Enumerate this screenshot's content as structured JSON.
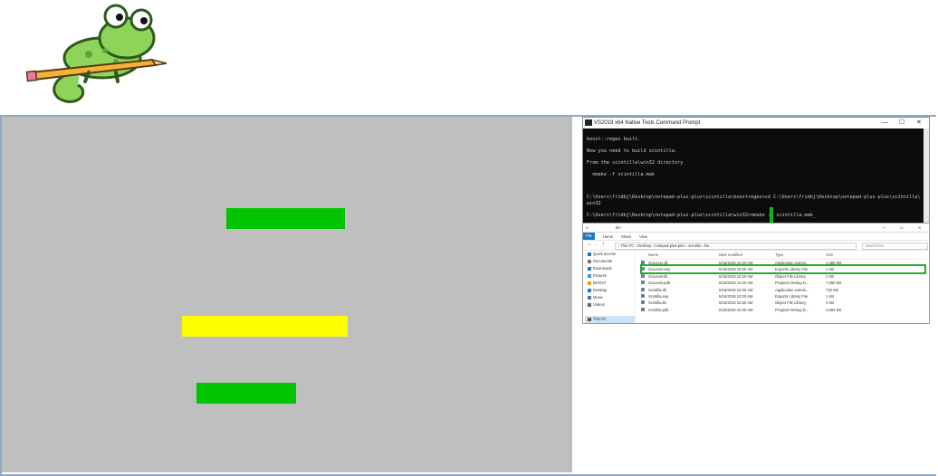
{
  "colors": {
    "highlight_green": "#00c400",
    "highlight_yellow": "#ffff00",
    "panel_gray": "#bfbfbf",
    "selection_green": "#24b024",
    "explorer_blue": "#1979ca"
  },
  "terminal": {
    "title": "VS2019 x64 Native Tools Command Prompt",
    "lines": [
      "",
      "boost::regex built.",
      "",
      "Now you need to build scintilla.",
      "",
      "From the scintilla\\win32 directory",
      "",
      "  nmake -f scintilla.mak",
      "",
      "",
      "",
      "C:\\Users\\fridbj\\Desktop\\notepad-plus-plus\\scintilla\\boostregex>cd C:\\Users\\fridbj\\Desktop\\notepad-plus-plus\\scintilla\\",
      "win32",
      "",
      "C:\\Users\\fridbj\\Desktop\\notepad-plus-plus\\scintilla\\win32>nmake -f scintilla.mak_"
    ]
  },
  "explorer": {
    "title": "bin",
    "tabs": {
      "file": "File",
      "home": "Home",
      "share": "Share",
      "view": "View"
    },
    "address": "› This PC › Desktop › notepad-plus-plus › scintilla › bin",
    "search_placeholder": "Search bin",
    "columns": {
      "name": "Name",
      "date": "Date modified",
      "type": "Type",
      "size": "Size"
    },
    "nav": [
      "Quick access",
      "Documents",
      "Downloads",
      "Pictures",
      "BOOST",
      "Desktop",
      "Music",
      "Videos",
      "",
      "This PC"
    ],
    "files": [
      {
        "name": "SciLexer.dll",
        "date": "5/16/2019 10:20 AM",
        "type": "Application extens...",
        "size": "1,366 KB"
      },
      {
        "name": "SciLexer.exp",
        "date": "5/16/2019 10:20 AM",
        "type": "Exports Library File",
        "size": "1 KB"
      },
      {
        "name": "SciLexer.lib",
        "date": "5/16/2019 10:20 AM",
        "type": "Object File Library",
        "size": "2 KB"
      },
      {
        "name": "SciLexer.pdb",
        "date": "5/16/2019 10:20 AM",
        "type": "Program Debug D...",
        "size": "7,060 KB"
      },
      {
        "name": "Scintilla.dll",
        "date": "5/16/2019 10:20 AM",
        "type": "Application extens...",
        "size": "732 KB"
      },
      {
        "name": "Scintilla.exp",
        "date": "5/16/2019 10:20 AM",
        "type": "Exports Library File",
        "size": "1 KB"
      },
      {
        "name": "Scintilla.lib",
        "date": "5/16/2019 10:20 AM",
        "type": "Object File Library",
        "size": "2 KB"
      },
      {
        "name": "Scintilla.pdb",
        "date": "5/16/2019 10:20 AM",
        "type": "Program Debug D...",
        "size": "4,964 KB"
      }
    ]
  }
}
